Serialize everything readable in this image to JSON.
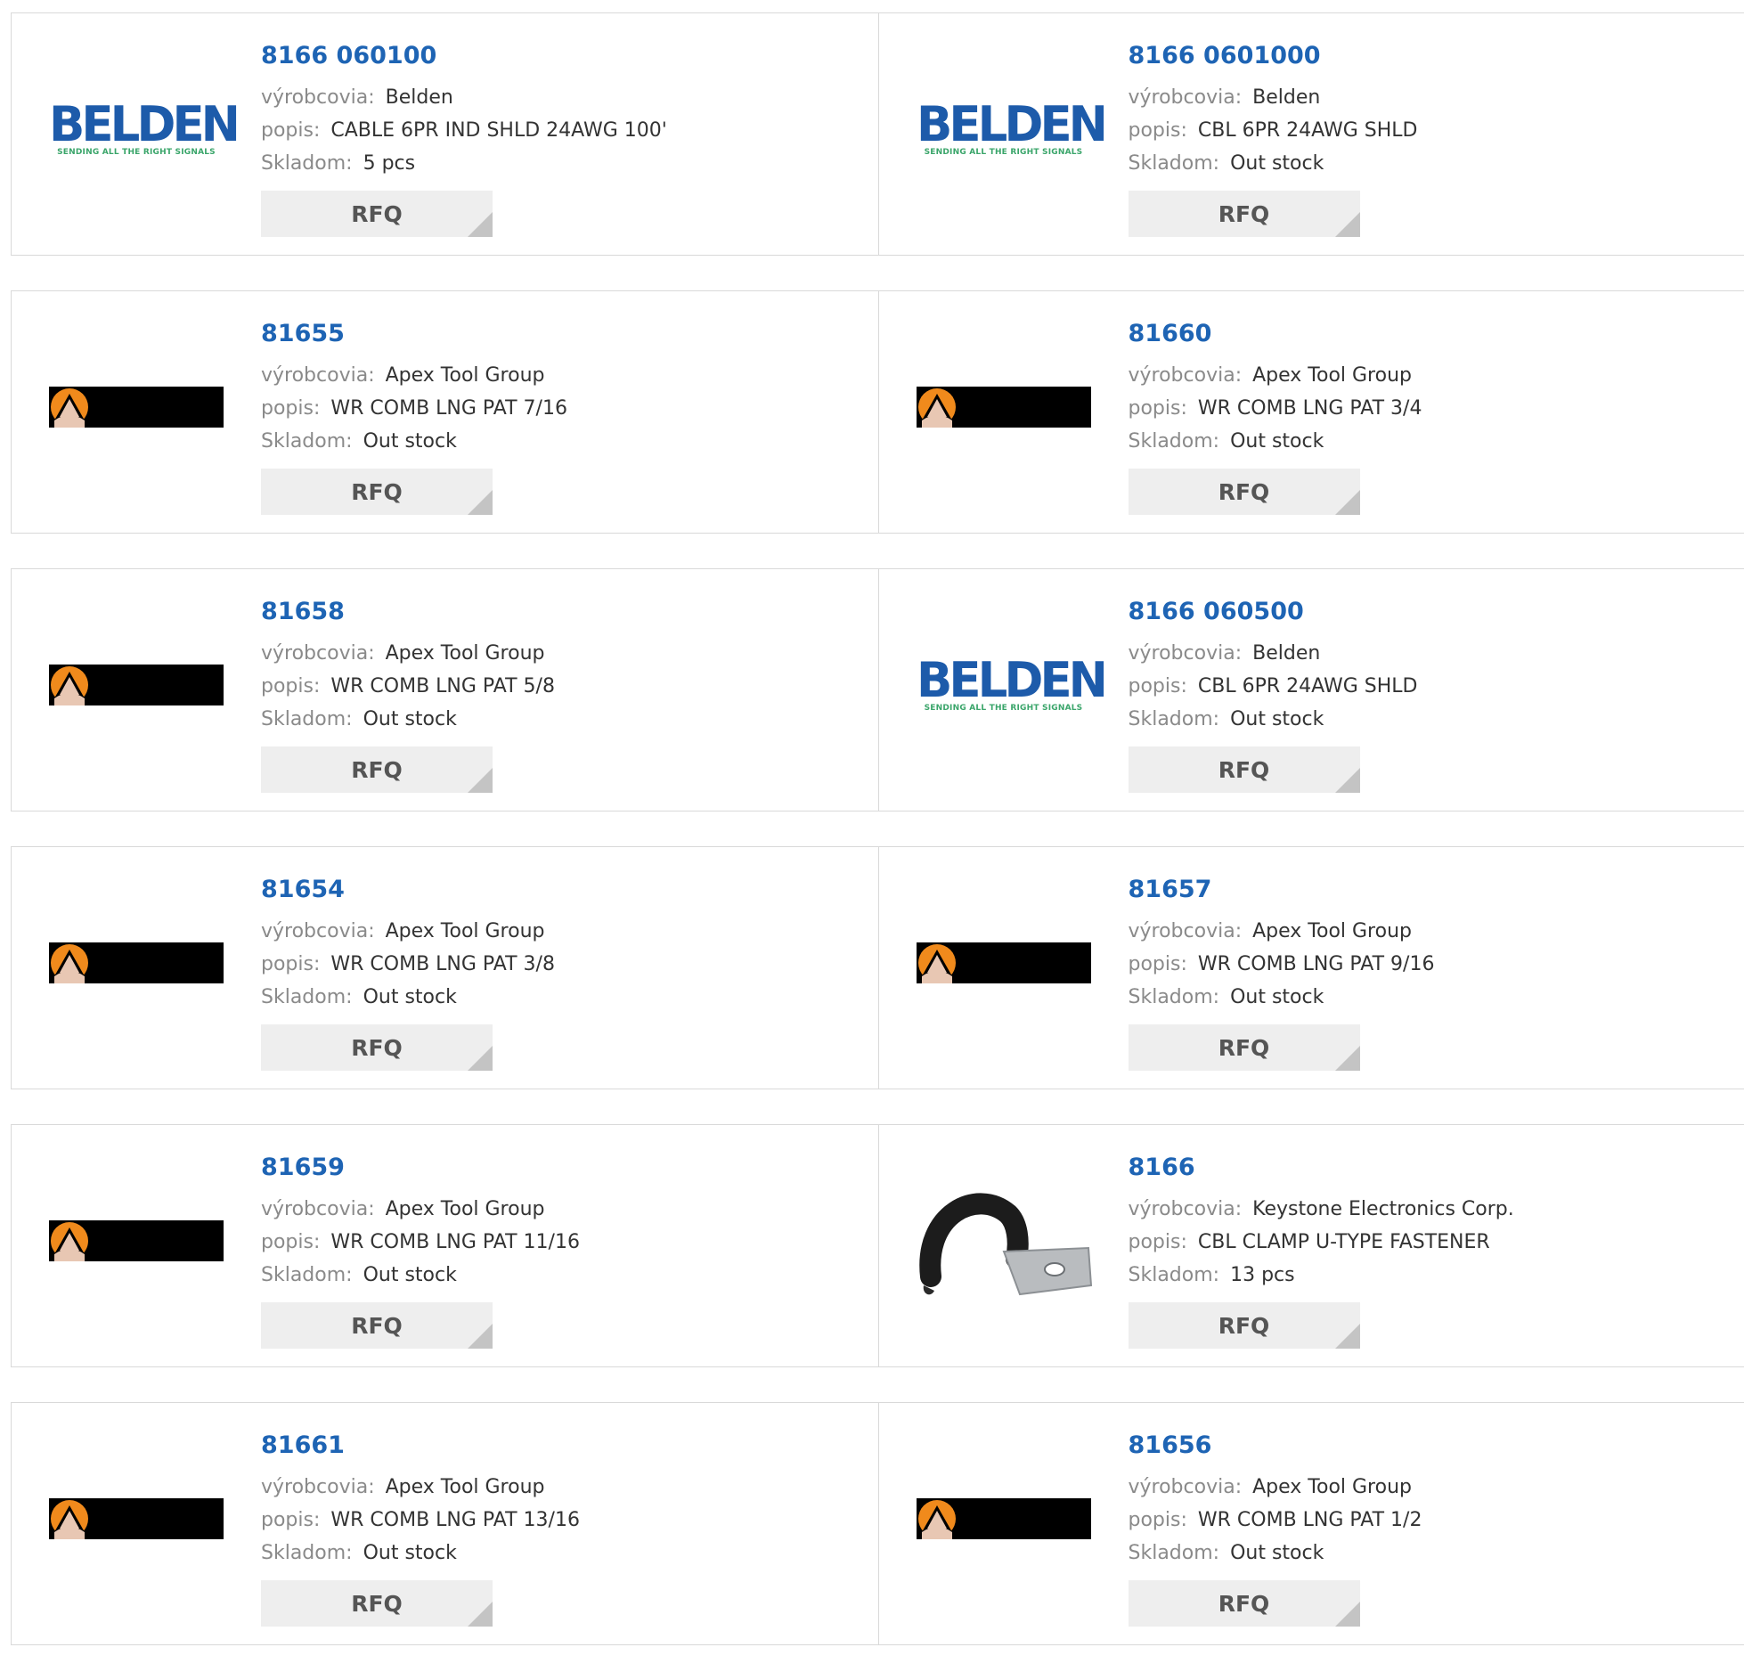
{
  "labels": {
    "manufacturer": "výrobcovia:",
    "description": "popis:",
    "stock": "Skladom:",
    "rfq": "RFQ"
  },
  "products": [
    {
      "part": "8166 060100",
      "manufacturer": "Belden",
      "description": "CABLE 6PR IND SHLD 24AWG 100'",
      "stock": "5 pcs",
      "logo": "belden-logo"
    },
    {
      "part": "8166 0601000",
      "manufacturer": "Belden",
      "description": "CBL 6PR 24AWG SHLD",
      "stock": "Out stock",
      "logo": "belden-logo"
    },
    {
      "part": "81655",
      "manufacturer": "Apex Tool Group",
      "description": "WR COMB LNG PAT 7/16",
      "stock": "Out stock",
      "logo": "apex-logo"
    },
    {
      "part": "81660",
      "manufacturer": "Apex Tool Group",
      "description": "WR COMB LNG PAT 3/4",
      "stock": "Out stock",
      "logo": "apex-logo"
    },
    {
      "part": "81658",
      "manufacturer": "Apex Tool Group",
      "description": "WR COMB LNG PAT 5/8",
      "stock": "Out stock",
      "logo": "apex-logo"
    },
    {
      "part": "8166 060500",
      "manufacturer": "Belden",
      "description": "CBL 6PR 24AWG SHLD",
      "stock": "Out stock",
      "logo": "belden-logo"
    },
    {
      "part": "81654",
      "manufacturer": "Apex Tool Group",
      "description": "WR COMB LNG PAT 3/8",
      "stock": "Out stock",
      "logo": "apex-logo"
    },
    {
      "part": "81657",
      "manufacturer": "Apex Tool Group",
      "description": "WR COMB LNG PAT 9/16",
      "stock": "Out stock",
      "logo": "apex-logo"
    },
    {
      "part": "81659",
      "manufacturer": "Apex Tool Group",
      "description": "WR COMB LNG PAT 11/16",
      "stock": "Out stock",
      "logo": "apex-logo"
    },
    {
      "part": "8166",
      "manufacturer": "Keystone Electronics Corp.",
      "description": "CBL CLAMP U-TYPE FASTENER",
      "stock": "13 pcs",
      "logo": "cable-clamp-photo"
    },
    {
      "part": "81661",
      "manufacturer": "Apex Tool Group",
      "description": "WR COMB LNG PAT 13/16",
      "stock": "Out stock",
      "logo": "apex-logo"
    },
    {
      "part": "81656",
      "manufacturer": "Apex Tool Group",
      "description": "WR COMB LNG PAT 1/2",
      "stock": "Out stock",
      "logo": "apex-logo"
    }
  ],
  "belden_logo": {
    "word": "BELDEN",
    "tagline": "SENDING ALL THE RIGHT SIGNALS"
  },
  "colors": {
    "part_link": "#1e64b4",
    "belden_blue": "#1d5baa",
    "belden_green": "#3aa56a",
    "rfq_bg": "#eeeeee"
  }
}
